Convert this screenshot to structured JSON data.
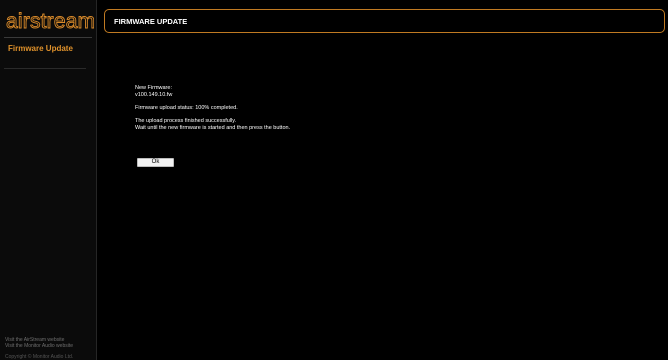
{
  "brand": {
    "name": "airstream",
    "accent_color": "#e0922b",
    "border_color": "#c07a22"
  },
  "sidebar": {
    "items": [
      {
        "label": "Firmware Update",
        "active": true
      }
    ],
    "footer_links": [
      "Visit the AirStream website",
      "Visit the Monitor Audio website"
    ],
    "copyright": "Copyright © Monitor Audio Ltd."
  },
  "content": {
    "title": "FIRMWARE UPDATE",
    "new_firmware_label": "New Firmware:",
    "new_firmware_file": "v100.149.10.fw",
    "upload_status": "Firmware upload status: 100% completed.",
    "upload_progress_percent": 100,
    "success_message": "The upload process finished successfully.",
    "instruction": "Wait until the new firmware is started and then press the button.",
    "ok_button_label": "Ok"
  }
}
